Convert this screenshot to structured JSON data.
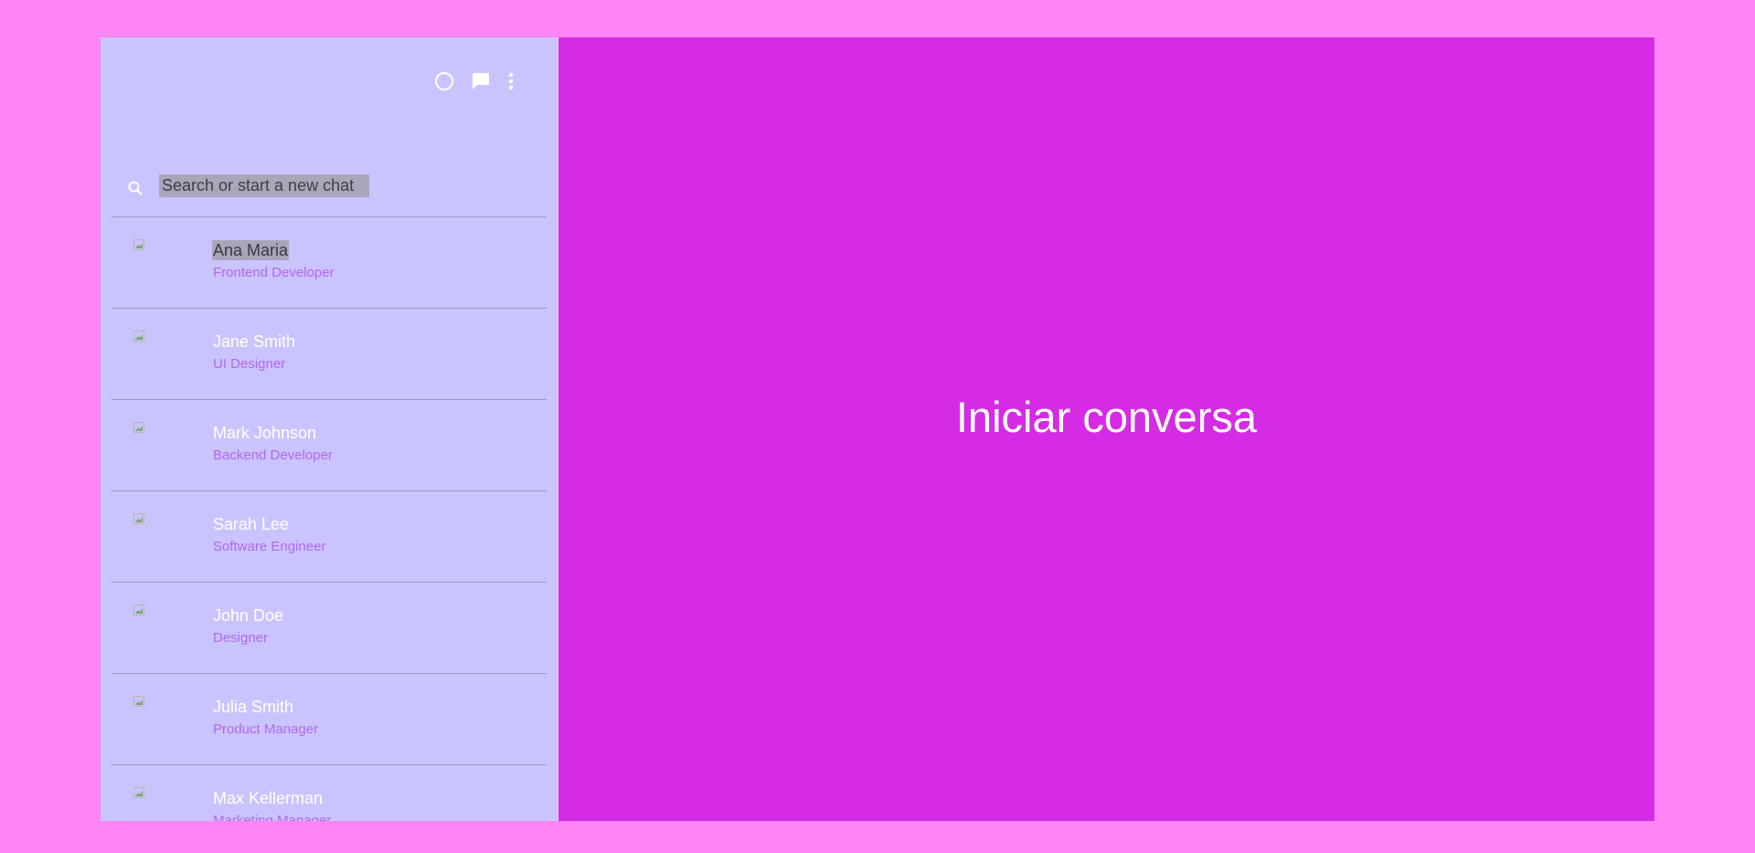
{
  "sidebar": {
    "header": {
      "icons": [
        "status-icon",
        "new-chat-icon",
        "more-vert-icon"
      ]
    },
    "search": {
      "placeholder": "Search or start a new chat",
      "value": ""
    },
    "contacts": [
      {
        "name": "Ana Maria",
        "role": "Frontend Developer"
      },
      {
        "name": "Jane Smith",
        "role": "UI Designer"
      },
      {
        "name": "Mark Johnson",
        "role": "Backend Developer"
      },
      {
        "name": "Sarah Lee",
        "role": "Software Engineer"
      },
      {
        "name": "John Doe",
        "role": "Designer"
      },
      {
        "name": "Julia Smith",
        "role": "Product Manager"
      },
      {
        "name": "Max Kellerman",
        "role": "Marketing Manager"
      }
    ]
  },
  "main": {
    "empty_state_text": "Iniciar conversa"
  },
  "colors": {
    "page_background": "#ff84f6",
    "sidebar_background": "#cac4fe",
    "main_background": "#d52be4",
    "role_text": "#b267ef",
    "divider": "#9d97c9"
  }
}
